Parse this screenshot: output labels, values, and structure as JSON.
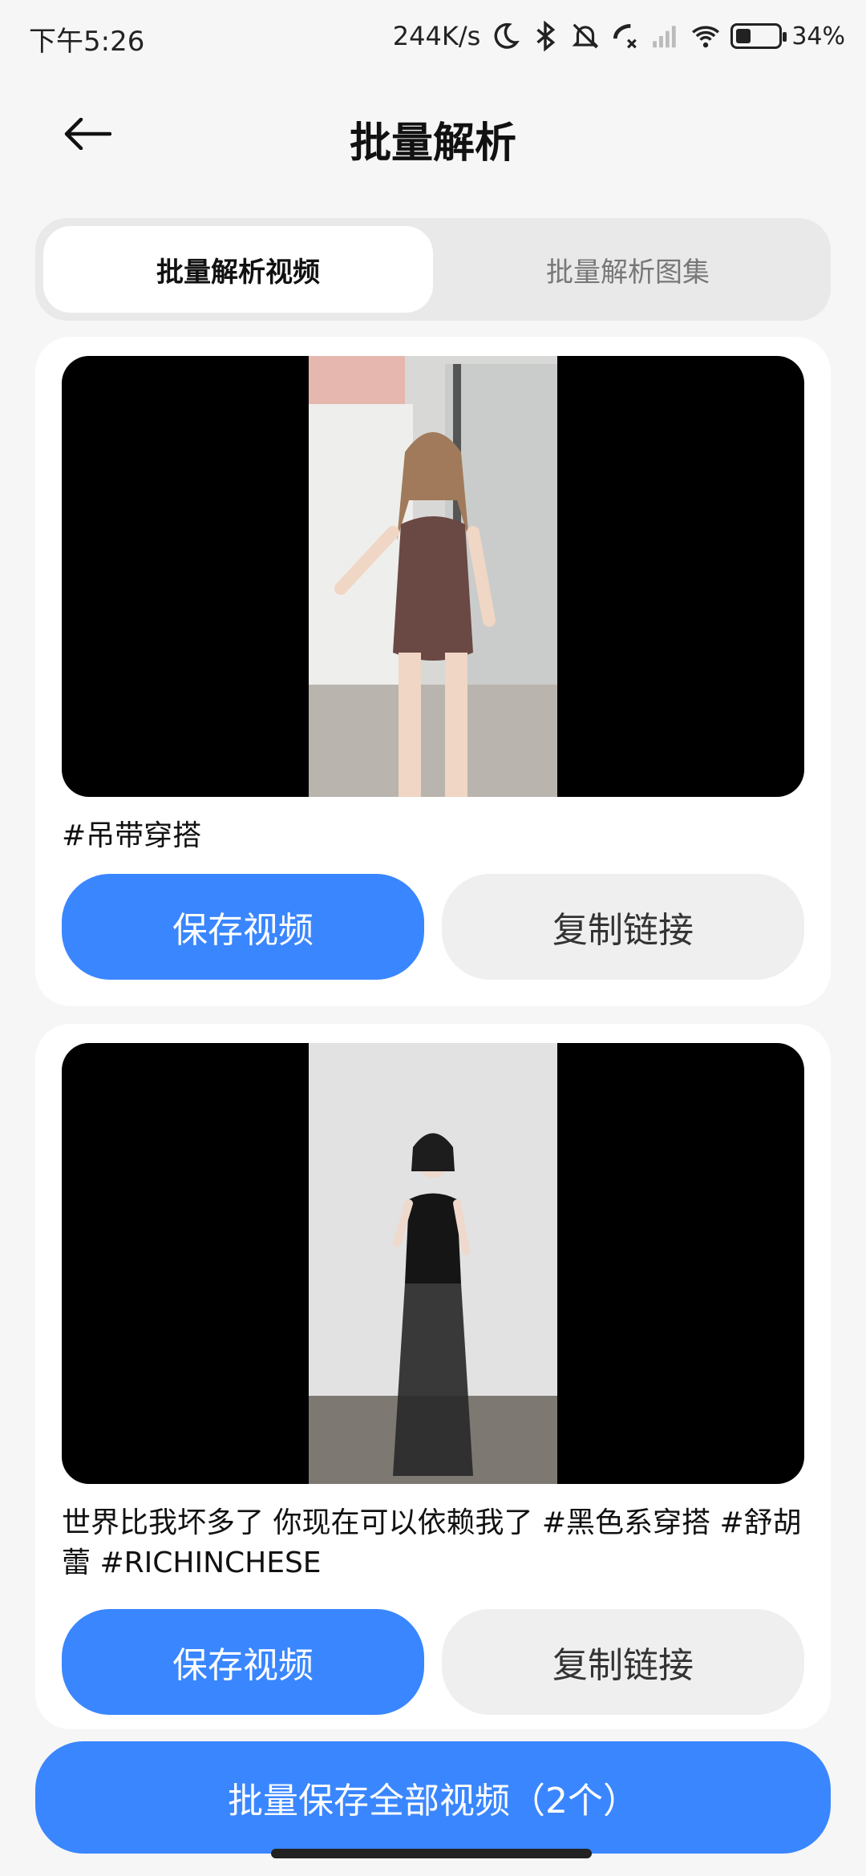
{
  "status_bar": {
    "time": "下午5:26",
    "net_speed": "244K/s",
    "battery_percent": "34%",
    "battery_level": 0.34,
    "icons": [
      "moon-icon",
      "bluetooth-icon",
      "mute-icon",
      "missed-call-icon",
      "signal-icon",
      "wifi-icon",
      "battery-icon"
    ]
  },
  "header": {
    "title": "批量解析",
    "back_icon": "arrow-left-icon"
  },
  "tabs": [
    {
      "label": "批量解析视频",
      "active": true
    },
    {
      "label": "批量解析图集",
      "active": false
    }
  ],
  "items": [
    {
      "caption": "#吊带穿搭",
      "save_label": "保存视频",
      "copy_label": "复制链接"
    },
    {
      "caption": "世界比我坏多了 你现在可以依赖我了 #黑色系穿搭 #舒胡蕾 #RICHINCHESE",
      "save_label": "保存视频",
      "copy_label": "复制链接"
    }
  ],
  "bottom_button": {
    "label": "批量保存全部视频（2个）"
  },
  "colors": {
    "accent": "#3a86ff",
    "background": "#f6f6f6",
    "card": "#ffffff"
  }
}
